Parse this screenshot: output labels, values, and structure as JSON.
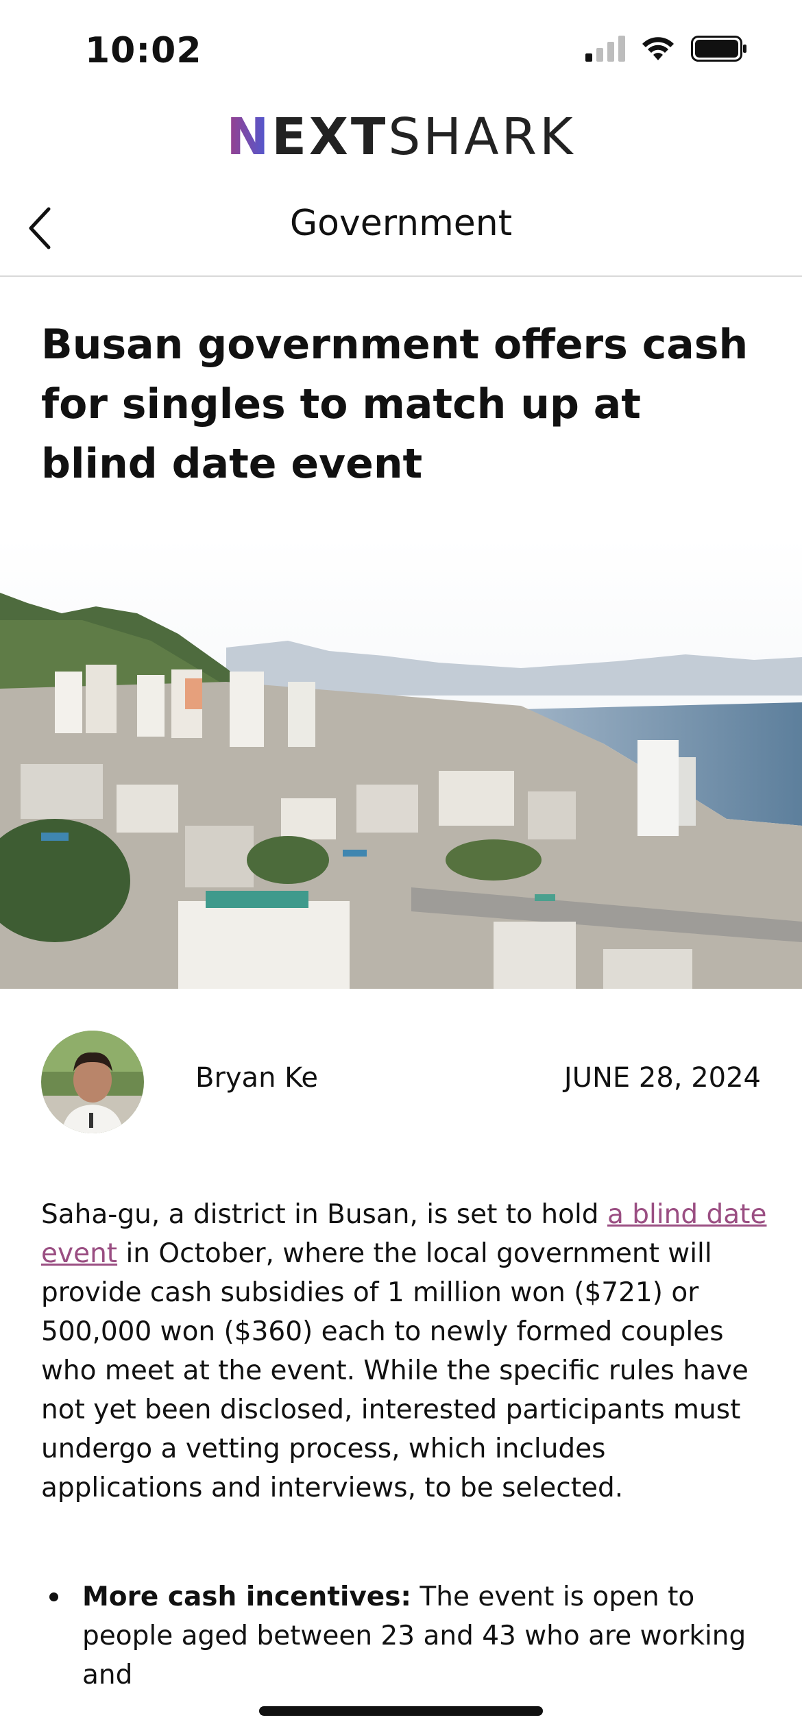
{
  "status_bar": {
    "time": "10:02"
  },
  "header": {
    "logo": {
      "part1": "N",
      "part2": "EXT",
      "part3": "SHARK"
    },
    "section_title": "Government"
  },
  "article": {
    "title": "Busan government offers cash for singles to match up at blind date event",
    "hero_image_alt": "Aerial view of Busan city",
    "author": "Bryan Ke",
    "date": "JUNE 28, 2024",
    "body": {
      "pre_link": "Saha-gu, a district in Busan, is set to hold ",
      "link_text": "a blind date event",
      "post_link": " in October, where the local government will provide cash subsidies of 1 million won ($721) or 500,000 won ($360) each to newly formed couples who meet at the event. While the specific rules have not yet been disclosed, interested participants must undergo a vetting process, which includes applications and interviews, to be selected."
    },
    "bullets": [
      {
        "bold": "More cash incentives:",
        "text": " The event is open to people aged between 23 and 43 who are working and"
      }
    ]
  },
  "colors": {
    "link": "#9a4e82",
    "logo_gradient_start": "#9b3f8a",
    "logo_gradient_end": "#4a5bd6"
  }
}
